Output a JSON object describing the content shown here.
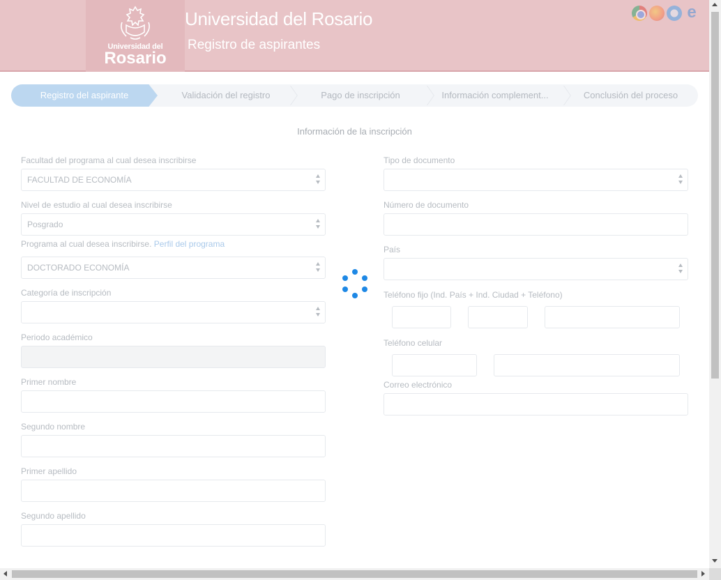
{
  "header": {
    "logo_line1": "Universidad del",
    "logo_line2": "Rosario",
    "title": "Universidad del Rosario",
    "subtitle": "Registro de aspirantes",
    "browser_icons": [
      "chrome-icon",
      "firefox-icon",
      "safari-icon",
      "internet-explorer-icon"
    ],
    "color": "#e8c4c7"
  },
  "stepper": {
    "steps": [
      {
        "label": "Registro del aspirante",
        "active": true
      },
      {
        "label": "Validación del registro",
        "active": false
      },
      {
        "label": "Pago de inscripción",
        "active": false
      },
      {
        "label": "Información complement...",
        "active": false
      },
      {
        "label": "Conclusión del proceso",
        "active": false
      }
    ],
    "active_color": "#bcd7f0"
  },
  "form": {
    "section_title": "Información de la inscripción",
    "faculty": {
      "label": "Facultad del programa al cual desea inscribirse",
      "value": "FACULTAD DE ECONOMÍA"
    },
    "level": {
      "label": "Nivel de estudio al cual desea inscribirse",
      "value": "Posgrado"
    },
    "program": {
      "label": "Programa al cual desea inscribirse.",
      "link": "Perfil del programa",
      "value": "DOCTORADO ECONOMÍA"
    },
    "category": {
      "label": "Categoría de inscripción",
      "value": ""
    },
    "period": {
      "label": "Periodo académico",
      "value": ""
    },
    "first_name": {
      "label": "Primer nombre",
      "value": ""
    },
    "second_name": {
      "label": "Segundo nombre",
      "value": ""
    },
    "first_surname": {
      "label": "Primer apellido",
      "value": ""
    },
    "second_surname": {
      "label": "Segundo apellido",
      "value": ""
    },
    "doc_type": {
      "label": "Tipo de documento",
      "value": ""
    },
    "doc_number": {
      "label": "Número de documento",
      "value": ""
    },
    "country": {
      "label": "País",
      "value": ""
    },
    "landline": {
      "label": "Teléfono fijo (Ind. País + Ind. Ciudad + Teléfono)"
    },
    "mobile": {
      "label": "Teléfono celular"
    },
    "email": {
      "label": "Correo electrónico",
      "value": ""
    }
  },
  "loading": {
    "spinner_color": "#1e88e5"
  }
}
